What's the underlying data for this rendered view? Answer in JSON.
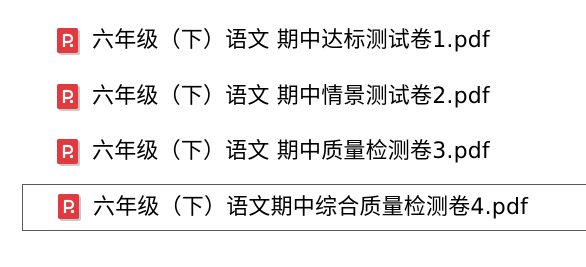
{
  "colors": {
    "pdf_icon_red": "#e03a3e",
    "pdf_icon_shadow": "#c9c9c9",
    "selection_border": "#5a5a5a"
  },
  "files": [
    {
      "name": "六年级（下）语文 期中达标测试卷1.pdf",
      "icon": "pdf-file-icon",
      "selected": false
    },
    {
      "name": "六年级（下）语文 期中情景测试卷2.pdf",
      "icon": "pdf-file-icon",
      "selected": false
    },
    {
      "name": "六年级（下）语文 期中质量检测卷3.pdf",
      "icon": "pdf-file-icon",
      "selected": false
    },
    {
      "name": "六年级（下）语文期中综合质量检测卷4.pdf",
      "icon": "pdf-file-icon",
      "selected": true
    }
  ]
}
